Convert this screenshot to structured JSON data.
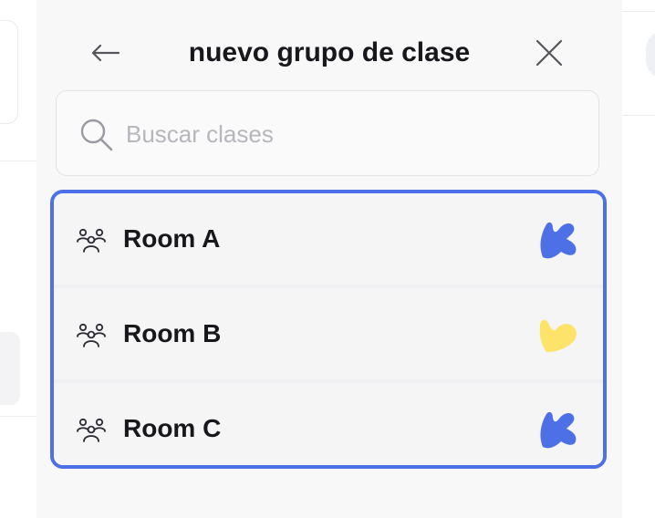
{
  "dialog": {
    "title": "nuevo grupo de clase"
  },
  "search": {
    "placeholder": "Buscar clases",
    "value": ""
  },
  "classes": [
    {
      "name": "Room A",
      "badge_icon": "blue-monster-icon",
      "badge_color": "#4e70e7"
    },
    {
      "name": "Room B",
      "badge_icon": "yellow-heart-icon",
      "badge_color": "#fde36a"
    },
    {
      "name": "Room C",
      "badge_icon": "blue-monster-icon",
      "badge_color": "#4e70e7"
    }
  ],
  "colors": {
    "accent": "#4e70e7",
    "panel_bg": "#f8f8f9",
    "text": "#17171c",
    "placeholder": "#b6b6bd"
  },
  "icons": {
    "back": "arrow-left-icon",
    "close": "close-icon",
    "search": "search-icon",
    "class": "group-icon"
  }
}
